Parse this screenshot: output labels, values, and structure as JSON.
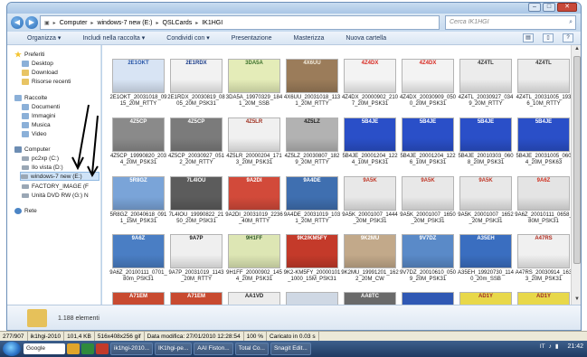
{
  "window": {
    "address": [
      "Computer",
      "windows-7 new (E:)",
      "QSLCards",
      "IK1HGI"
    ],
    "search_placeholder": "Cerca IK1HGI"
  },
  "toolbar": {
    "organize": "Organizza ▾",
    "include": "Includi nella raccolta ▾",
    "share": "Condividi con ▾",
    "slideshow": "Presentazione",
    "burn": "Masterizza",
    "new_folder": "Nuova cartella"
  },
  "navpane": {
    "favorites": "Preferiti",
    "desktop": "Desktop",
    "download": "Download",
    "recent": "Risorse recenti",
    "libraries": "Raccolte",
    "documents": "Documenti",
    "images": "Immagini",
    "music": "Musica",
    "video": "Video",
    "computer": "Computer",
    "drive_c": "pc2xp (C:)",
    "drive_d": "Ilo vista (D:)",
    "drive_e": "windows-7 new (E:)",
    "drive_f": "FACTORY_IMAGE (F",
    "drive_g": "Unità DVD RW (G:) N",
    "network": "Rete"
  },
  "files": [
    {
      "name": "2E1OKT_20031018_0915_20M_RTTY",
      "label": "2E1OKT",
      "bg": "#d8e4f4",
      "accent": "#2a57a8"
    },
    {
      "name": "2E1RDX_20030819_0805_20M_PSK31",
      "label": "2E1RDX",
      "bg": "#f2f2f2",
      "accent": "#1b3d8a"
    },
    {
      "name": "3DA5A_19970329_1841_20M_SSB",
      "label": "3DA5A",
      "bg": "#e4ecb8",
      "accent": "#3a6f2a"
    },
    {
      "name": "4X6UU_20031018_1131_20M_RTTY",
      "label": "4X6UU",
      "bg": "#9b7c5a",
      "accent": "#f5efe0"
    },
    {
      "name": "4Z4DX_20000902_2107_20M_PSK31",
      "label": "4Z4DX",
      "bg": "#f3f3f3",
      "accent": "#d7261e"
    },
    {
      "name": "4Z4DX_20030909_0500_20M_PSK31",
      "label": "4Z4DX",
      "bg": "#f3f3f3",
      "accent": "#d7261e"
    },
    {
      "name": "4Z4TL_20030927_0349_20M_RTTY",
      "label": "4Z4TL",
      "bg": "#ececec",
      "accent": "#3a3a3a"
    },
    {
      "name": "4Z4TL_20031005_1936_10M_RTTY",
      "label": "4Z4TL",
      "bg": "#ececec",
      "accent": "#3a3a3a"
    },
    {
      "name": "4Z5CP_19990820_2034_20M_PSK31",
      "label": "4Z5CP",
      "bg": "#8a8a8a",
      "accent": "#ffffff"
    },
    {
      "name": "4Z5CP_20030927_0512_20M_RTTY",
      "label": "4Z5CP",
      "bg": "#7b7b7b",
      "accent": "#ffffff"
    },
    {
      "name": "4Z5LR_20000204_1713_20M_PSK31",
      "label": "4Z5LR",
      "bg": "#f0f0f0",
      "accent": "#a03020"
    },
    {
      "name": "4Z5LZ_20030807_1829_20M_RTTY",
      "label": "4Z5LZ",
      "bg": "#b2b2b2",
      "accent": "#222222"
    },
    {
      "name": "5B4JE_20001204_1224_10M_PSK31",
      "label": "5B4JE",
      "bg": "#2a4fc8",
      "accent": "#ffffff"
    },
    {
      "name": "5B4JE_20001204_1226_10M_PSK31",
      "label": "5B4JE",
      "bg": "#2a4fc8",
      "accent": "#ffffff"
    },
    {
      "name": "5B4JE_20010303_0608_20M_PSK31",
      "label": "5B4JE",
      "bg": "#2a4fc8",
      "accent": "#ffffff"
    },
    {
      "name": "5B4JE_20031005_0604_20M_PSK63",
      "label": "5B4JE",
      "bg": "#2a4fc8",
      "accent": "#ffffff"
    },
    {
      "name": "5R8GZ_20040618_0911_15M_PSK31",
      "label": "5R8GZ",
      "bg": "#7aa4d8",
      "accent": "#ffffff"
    },
    {
      "name": "7L4IOU_19990822_2150_20M_PSK31",
      "label": "7L4IOU",
      "bg": "#5c5c5c",
      "accent": "#ffffff"
    },
    {
      "name": "9A2DI_20031019_2236_40M_RTTY",
      "label": "9A2DI",
      "bg": "#d24a3a",
      "accent": "#ffffff"
    },
    {
      "name": "9A4DE_20031019_1031_20M_RTTY",
      "label": "9A4DE",
      "bg": "#3f6fb0",
      "accent": "#ffffff"
    },
    {
      "name": "9A5K_20001007_1444_20M_PSK31",
      "label": "9A5K",
      "bg": "#e8e8e8",
      "accent": "#c03828"
    },
    {
      "name": "9A5K_20001007_1650_20M_PSK31",
      "label": "9A5K",
      "bg": "#e8e8e8",
      "accent": "#c03828"
    },
    {
      "name": "9A5K_20001007_1652_20M_PSK31",
      "label": "9A5K",
      "bg": "#e8e8e8",
      "accent": "#c03828"
    },
    {
      "name": "9A6Z_20010111_0658_80M_PSK31",
      "label": "9A6Z",
      "bg": "#e4e4e4",
      "accent": "#d03020"
    },
    {
      "name": "9A6Z_20100111_0701_80m_PSK31",
      "label": "9A6Z",
      "bg": "#4a7ec4",
      "accent": "#ffffff"
    },
    {
      "name": "9A7P_20031019_1143_20M_RTTY",
      "label": "9A7P",
      "bg": "#efefef",
      "accent": "#1a1a1a"
    },
    {
      "name": "9H1FF_20000902_1454_20M_PSK31",
      "label": "9H1FF",
      "bg": "#dde6b4",
      "accent": "#2f5a2a"
    },
    {
      "name": "9K2-KM5FY_20000101_1000_15M_PSK31",
      "label": "9K2/KM5FY",
      "bg": "#c43a2a",
      "accent": "#ffffff"
    },
    {
      "name": "9K2MU_19991201_1622_20M_CW",
      "label": "9K2MU",
      "bg": "#c2a98a",
      "accent": "#ffffff"
    },
    {
      "name": "9V7DZ_20010610_0509_20M_PSK31",
      "label": "9V7DZ",
      "bg": "#5a8ac8",
      "accent": "#ffffff"
    },
    {
      "name": "A35EH_19920730_1140_20m_SSB",
      "label": "A35EH",
      "bg": "#3a6ec0",
      "accent": "#ffffff"
    },
    {
      "name": "A47RS_20030914_1633_20M_PSK31",
      "label": "A47RS",
      "bg": "#f0f0f0",
      "accent": "#b02a1e"
    },
    {
      "name": "",
      "label": "A71EM",
      "bg": "#c84a30",
      "accent": "#ffffff"
    },
    {
      "name": "",
      "label": "A71EM",
      "bg": "#c84a30",
      "accent": "#ffffff"
    },
    {
      "name": "",
      "label": "AA1VD",
      "bg": "#ececec",
      "accent": "#222222"
    },
    {
      "name": "",
      "label": "",
      "bg": "#cfd8e4",
      "accent": "#333333"
    },
    {
      "name": "",
      "label": "AA8TC",
      "bg": "#6a6a6a",
      "accent": "#ffffff"
    },
    {
      "name": "",
      "label": "",
      "bg": "#2f58b4",
      "accent": "#ffffff"
    },
    {
      "name": "",
      "label": "AD1Y",
      "bg": "#e8d84a",
      "accent": "#a0302a"
    },
    {
      "name": "",
      "label": "AD1Y",
      "bg": "#e8d84a",
      "accent": "#a0302a"
    }
  ],
  "details": {
    "count": "1.188 elementi"
  },
  "statusbar": {
    "index": "277/907",
    "file": "ik1hgi-2010",
    "size": "101,4 KB",
    "dims": "516x408x256 gif",
    "date": "Data modifica: 27/01/2010 12:28:54",
    "zoom": "100 %",
    "load": "Caricato in 0.03 s"
  },
  "taskbar": {
    "google": "Google",
    "items": [
      "ik1hgi-2010...",
      "IK1hgi-pe...",
      "AAI Fiston...",
      "Total Co...",
      "Snagit Edit..."
    ],
    "lang": "IT",
    "clock": "21:42"
  }
}
